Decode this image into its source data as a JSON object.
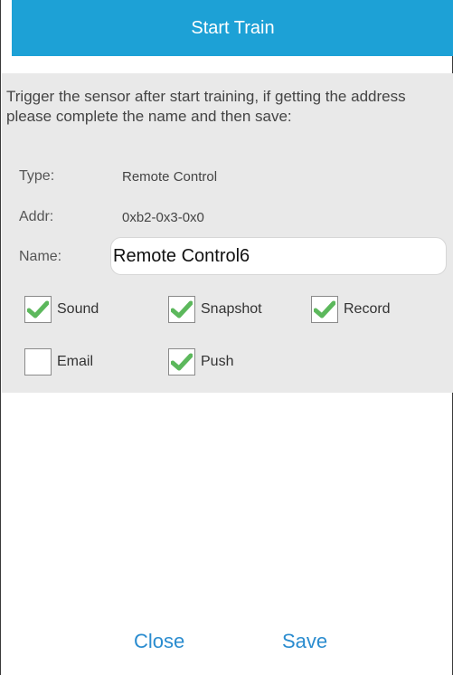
{
  "header": {
    "button_label": "Start Train",
    "accent_color": "#1da1d6"
  },
  "panel": {
    "instructions": "Trigger the sensor after start training, if getting the address\nplease complete the name and then save:",
    "type_label": "Type:",
    "type_value": "Remote Control",
    "addr_label": "Addr:",
    "addr_value": "0xb2-0x3-0x0",
    "name_label": "Name:",
    "name_value": "Remote Control6"
  },
  "options": [
    {
      "label": "Sound",
      "checked": true
    },
    {
      "label": "Snapshot",
      "checked": true
    },
    {
      "label": "Record",
      "checked": true
    },
    {
      "label": "Email",
      "checked": false
    },
    {
      "label": "Push",
      "checked": true
    }
  ],
  "footer": {
    "close_label": "Close",
    "save_label": "Save",
    "link_color": "#2a8ccf"
  },
  "icons": {
    "check": "checkmark-icon"
  }
}
